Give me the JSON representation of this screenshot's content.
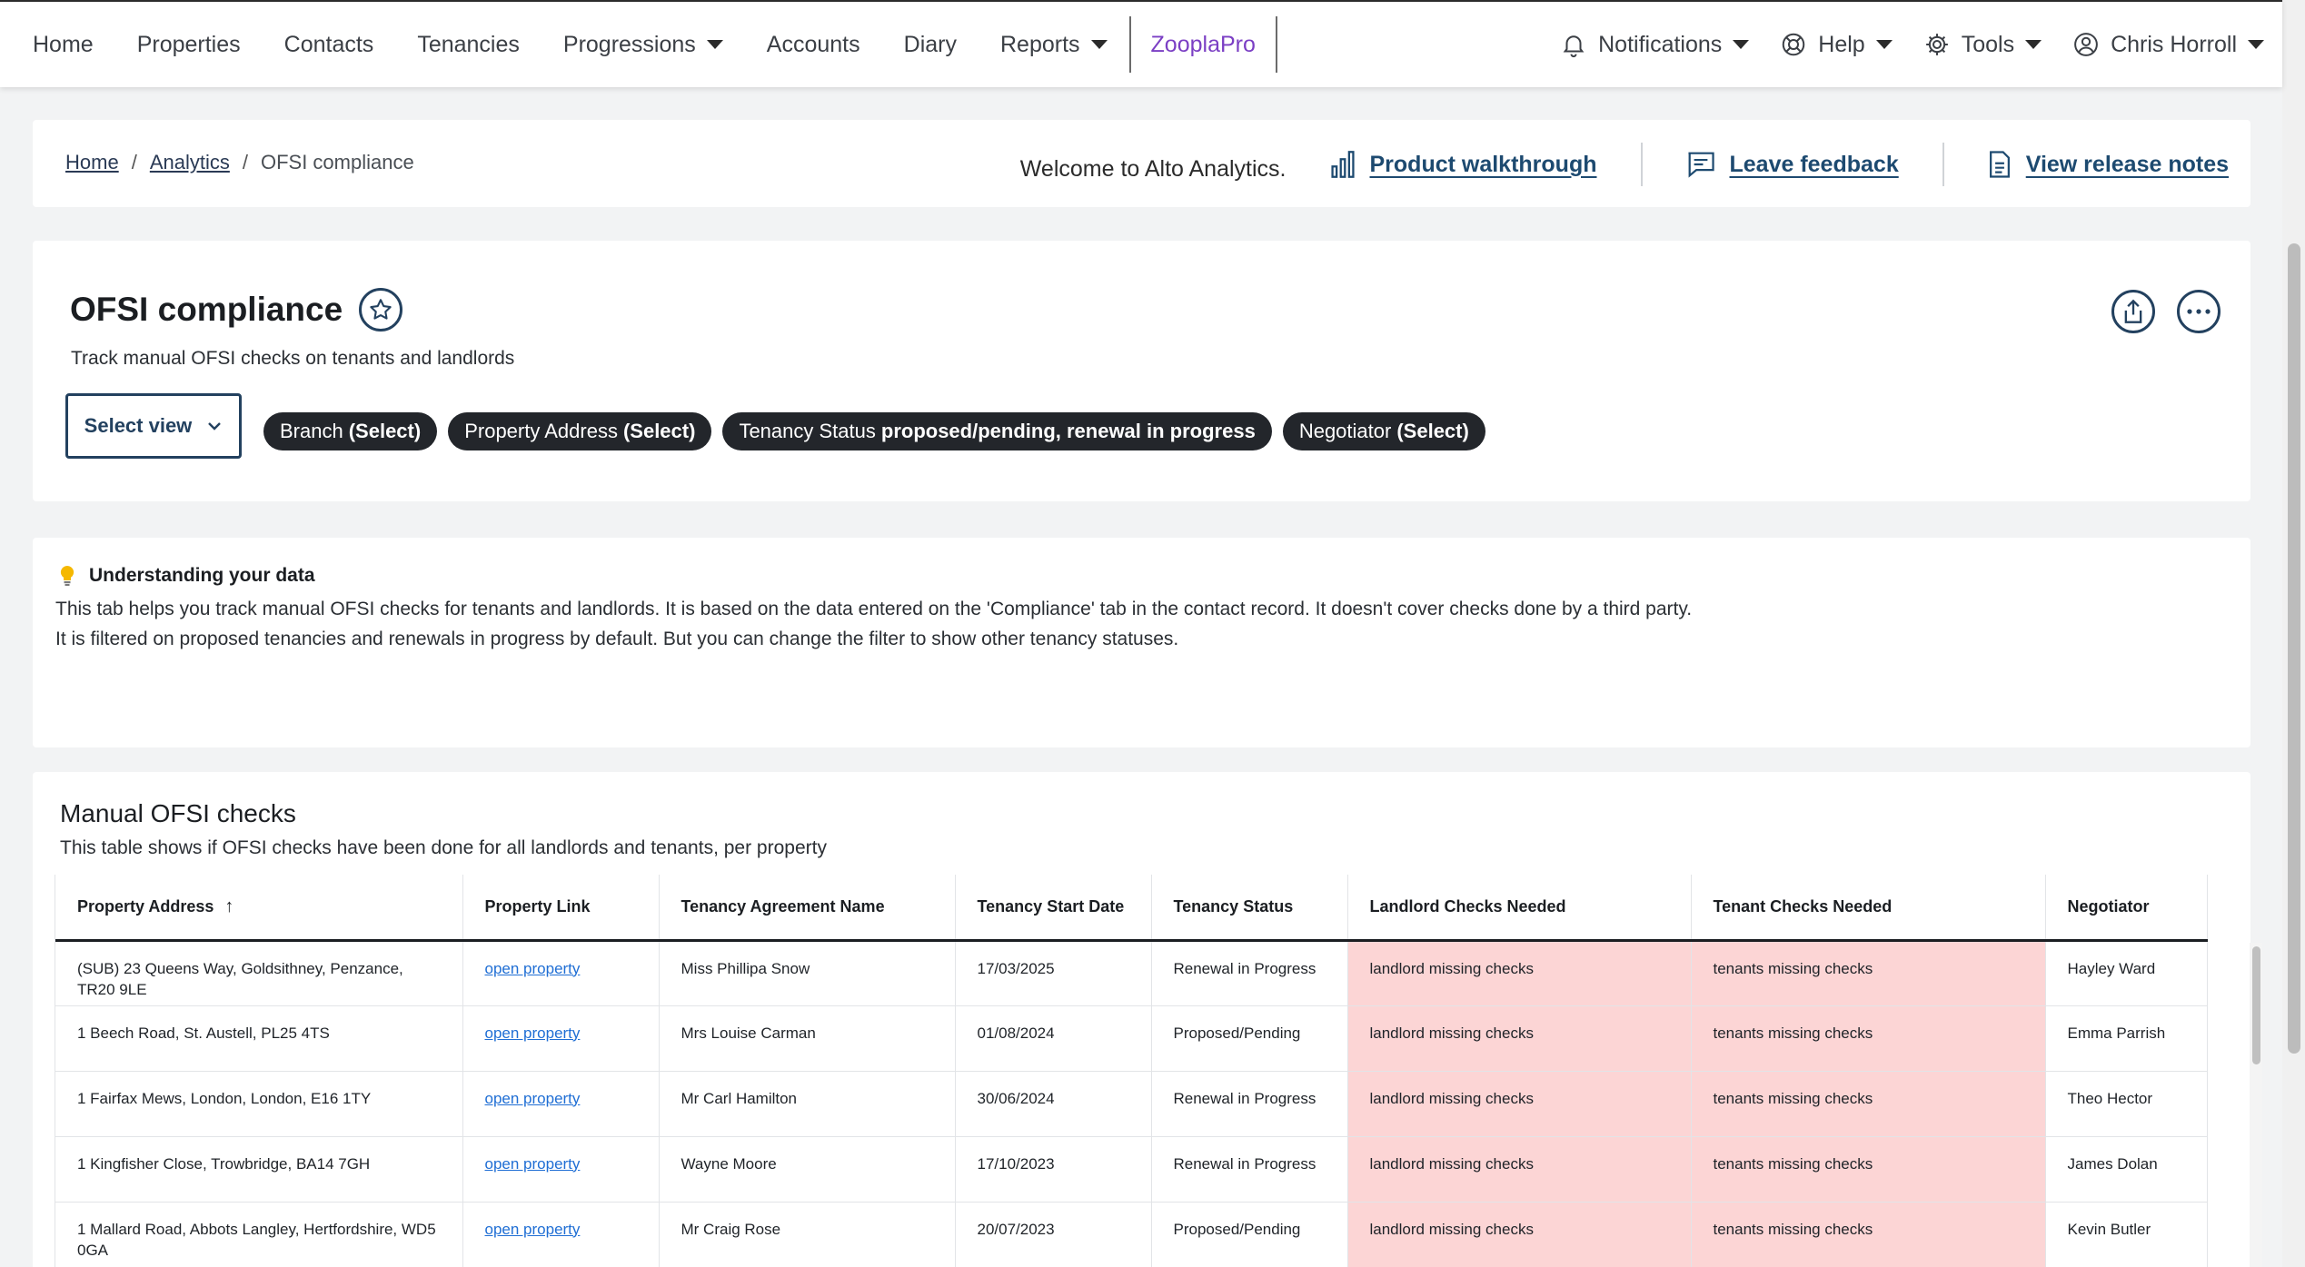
{
  "nav": {
    "left": [
      {
        "label": "Home",
        "caret": false
      },
      {
        "label": "Properties",
        "caret": false
      },
      {
        "label": "Contacts",
        "caret": false
      },
      {
        "label": "Tenancies",
        "caret": false
      },
      {
        "label": "Progressions",
        "caret": true
      },
      {
        "label": "Accounts",
        "caret": false
      },
      {
        "label": "Diary",
        "caret": false
      },
      {
        "label": "Reports",
        "caret": true
      }
    ],
    "zoopla": "ZooplaPro",
    "notifications": "Notifications",
    "help": "Help",
    "tools": "Tools",
    "user": "Chris Horroll",
    "accent": "#7b3fc4"
  },
  "breadcrumb": {
    "home": "Home",
    "analytics": "Analytics",
    "current": "OFSI compliance",
    "welcome": "Welcome to Alto Analytics.",
    "walkthrough": "Product walkthrough",
    "feedback": "Leave feedback",
    "release_notes": "View release notes"
  },
  "header": {
    "title": "OFSI compliance",
    "subtitle": "Track manual OFSI checks on tenants and landlords",
    "select_view": "Select view",
    "chips": [
      {
        "name": "Branch",
        "value": "(Select)"
      },
      {
        "name": "Property Address",
        "value": "(Select)"
      },
      {
        "name": "Tenancy Status",
        "value": "proposed/pending, renewal in progress"
      },
      {
        "name": "Negotiator",
        "value": "(Select)"
      }
    ]
  },
  "info": {
    "title": "Understanding your data",
    "line1": "This tab helps you track manual OFSI checks for tenants and landlords. It is based on the data entered on the 'Compliance' tab in the contact record. It doesn't cover checks done by a third party.",
    "line2": "It is filtered on proposed tenancies and renewals in progress by default. But you can change the filter to show other tenancy statuses."
  },
  "table": {
    "title": "Manual OFSI checks",
    "subtitle": "This table shows if OFSI checks have been done for all landlords and tenants, per property",
    "columns": [
      "Property Address",
      "Property Link",
      "Tenancy Agreement Name",
      "Tenancy Start Date",
      "Tenancy Status",
      "Landlord Checks Needed",
      "Tenant Checks Needed",
      "Negotiator"
    ],
    "flag_color": "#fcd5d5",
    "rows": [
      [
        "(SUB) 23 Queens Way, Goldsithney, Penzance, TR20 9LE",
        "open property",
        "Miss Phillipa Snow",
        "17/03/2025",
        "Renewal in Progress",
        "landlord missing checks",
        "tenants missing checks",
        "Hayley Ward"
      ],
      [
        "1 Beech Road, St. Austell, PL25 4TS",
        "open property",
        "Mrs Louise Carman",
        "01/08/2024",
        "Proposed/Pending",
        "landlord missing checks",
        "tenants missing checks",
        "Emma Parrish"
      ],
      [
        "1 Fairfax Mews, London, London, E16 1TY",
        "open property",
        "Mr Carl Hamilton",
        "30/06/2024",
        "Renewal in Progress",
        "landlord missing checks",
        "tenants missing checks",
        "Theo Hector"
      ],
      [
        "1 Kingfisher Close, Trowbridge, BA14 7GH",
        "open property",
        "Wayne Moore",
        "17/10/2023",
        "Renewal in Progress",
        "landlord missing checks",
        "tenants missing checks",
        "James Dolan"
      ],
      [
        "1 Mallard Road, Abbots Langley, Hertfordshire, WD5 0GA",
        "open property",
        "Mr Craig Rose",
        "20/07/2023",
        "Proposed/Pending",
        "landlord missing checks",
        "tenants missing checks",
        "Kevin Butler"
      ]
    ]
  }
}
